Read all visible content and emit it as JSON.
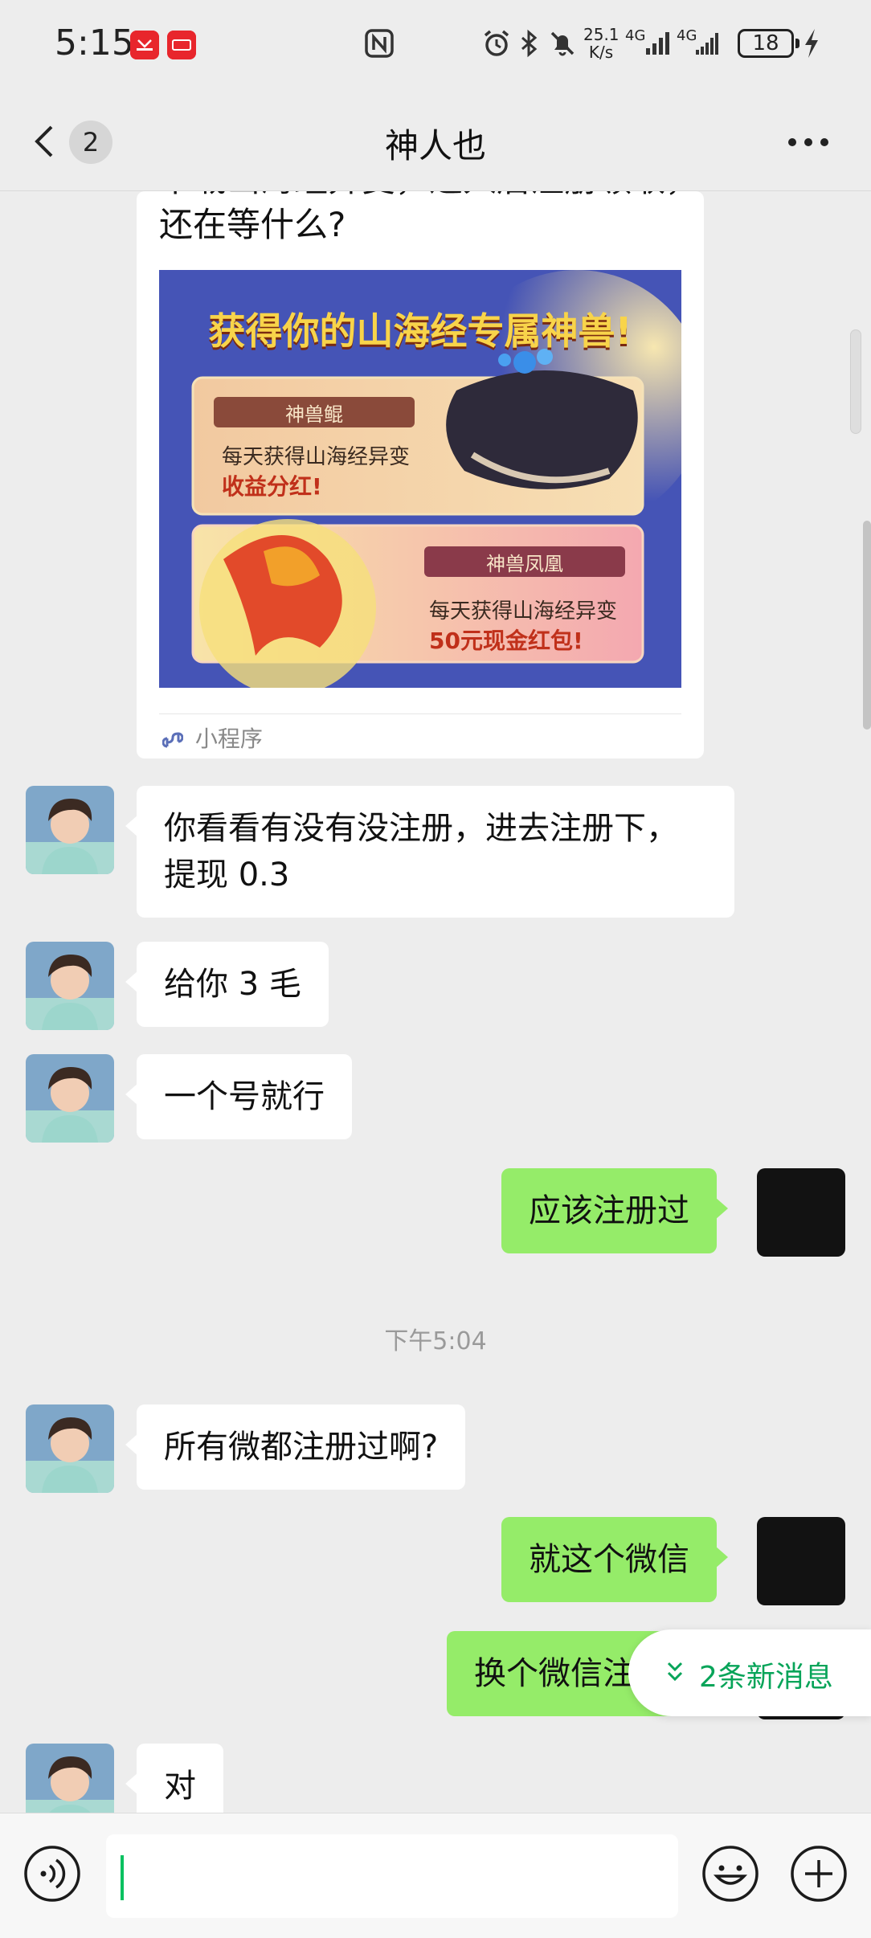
{
  "status_bar": {
    "time": "5:15",
    "app_badges": [
      "HUAWEI",
      "ReMix"
    ],
    "net_speed_top": "25.1",
    "net_speed_bottom": "K/s",
    "signal_1": "4G",
    "signal_2": "4G",
    "battery_level": "18",
    "icons": [
      "nfc-icon",
      "alarm-icon",
      "bluetooth-icon",
      "mute-icon",
      "signal-icon",
      "battery-icon",
      "charging-icon"
    ]
  },
  "header": {
    "back_icon": "chevron-left-icon",
    "unread_count": "2",
    "title": "神人也",
    "more_icon": "more-horizontal-icon"
  },
  "messages": {
    "mini_program": {
      "text_cut": "下载山海经异变，进入后注册领取，",
      "text": "还在等什么?",
      "image_title": "获得你的山海经专属神兽!",
      "card1_tag": "神兽鲲",
      "card1_line1": "每天获得山海经异变",
      "card1_line2": "收益分红!",
      "card2_tag": "神兽凤凰",
      "card2_line1": "每天获得山海经异变",
      "card2_line2": "50元现金红包!",
      "footer_label": "小程序"
    },
    "msg1_line1": "你看看有没有没注册，进去注册下，",
    "msg1_line2": "提现 0.3",
    "msg2": "给你 3 毛",
    "msg3": "一个号就行",
    "msg4": "应该注册过",
    "timestamp": "下午5:04",
    "msg5": "所有微都注册过啊?",
    "msg6": "就这个微信",
    "msg7": "换个微信注册",
    "msg8": "对"
  },
  "new_messages": {
    "label": "2条新消息",
    "icon": "double-chevron-down-icon"
  },
  "input_bar": {
    "voice_icon": "voice-icon",
    "input_value": "",
    "emoji_icon": "emoji-icon",
    "plus_icon": "plus-circle-icon"
  },
  "colors": {
    "outgoing_bubble": "#95ec69",
    "incoming_bubble": "#ffffff",
    "background": "#ededed",
    "accent_green": "#07c160"
  }
}
